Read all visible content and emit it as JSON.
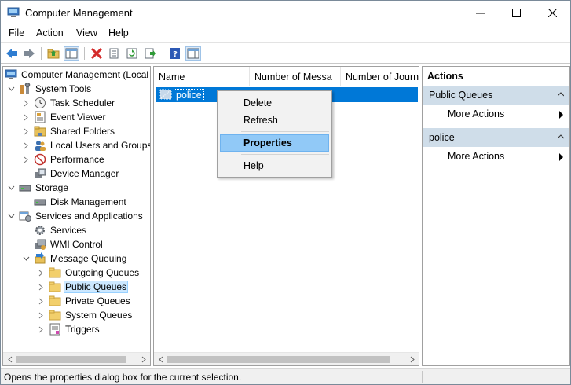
{
  "window": {
    "title": "Computer Management"
  },
  "menu": [
    "File",
    "Action",
    "View",
    "Help"
  ],
  "toolbar": {
    "icons": [
      "back-icon",
      "forward-icon",
      "up-folder-icon",
      "show-hide-tree-icon",
      "delete-icon",
      "properties-icon",
      "refresh-icon",
      "export-list-icon",
      "help-icon",
      "show-hide-action-pane-icon"
    ]
  },
  "tree": {
    "items": [
      {
        "label": "Computer Management (Local"
      },
      {
        "label": "System Tools"
      },
      {
        "label": "Task Scheduler"
      },
      {
        "label": "Event Viewer"
      },
      {
        "label": "Shared Folders"
      },
      {
        "label": "Local Users and Groups"
      },
      {
        "label": "Performance"
      },
      {
        "label": "Device Manager"
      },
      {
        "label": "Storage"
      },
      {
        "label": "Disk Management"
      },
      {
        "label": "Services and Applications"
      },
      {
        "label": "Services"
      },
      {
        "label": "WMI Control"
      },
      {
        "label": "Message Queuing"
      },
      {
        "label": "Outgoing Queues"
      },
      {
        "label": "Public Queues"
      },
      {
        "label": "Private Queues"
      },
      {
        "label": "System Queues"
      },
      {
        "label": "Triggers"
      }
    ]
  },
  "list": {
    "columns": [
      "Name",
      "Number of Messa",
      "Number of Journ"
    ],
    "rows": [
      {
        "name": "police"
      }
    ]
  },
  "context_menu": {
    "items": [
      "Delete",
      "Refresh",
      "Properties",
      "Help"
    ],
    "highlighted": "Properties"
  },
  "actions": {
    "title": "Actions",
    "sections": [
      {
        "title": "Public Queues",
        "item": "More Actions"
      },
      {
        "title": "police",
        "item": "More Actions"
      }
    ]
  },
  "status": {
    "text": "Opens the properties dialog box for the current selection."
  },
  "colors": {
    "selection": "#0078d7",
    "section_bg": "#cfdde9",
    "menu_highlight": "#91c9f7",
    "tree_selected": "#cce8ff"
  }
}
